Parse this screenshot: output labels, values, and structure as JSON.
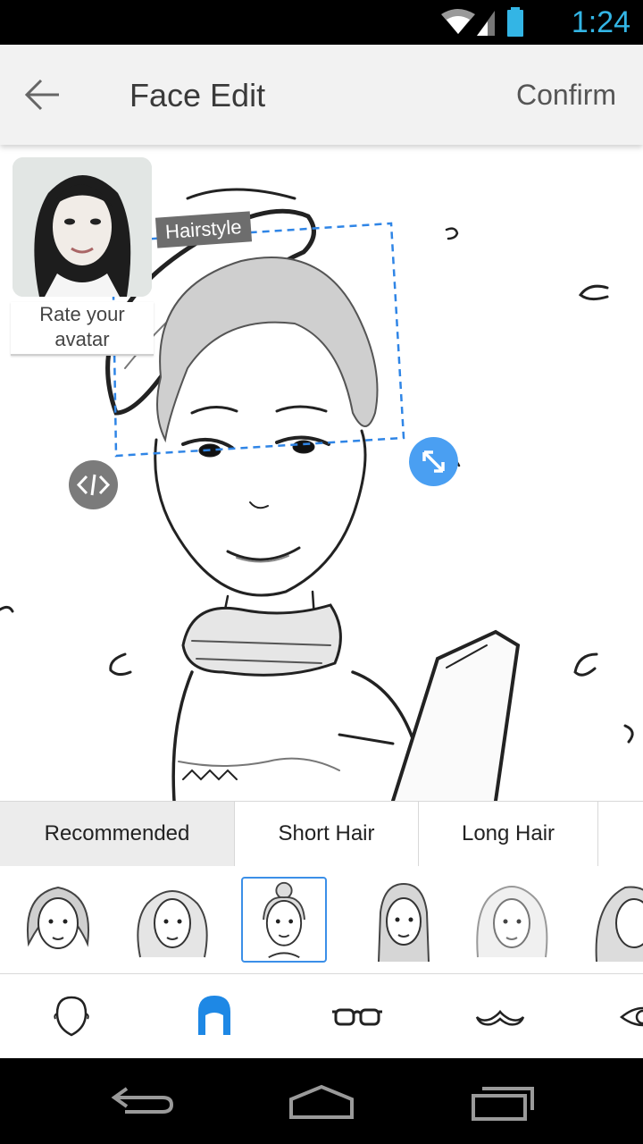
{
  "status_bar": {
    "time": "1:24",
    "icons": [
      "wifi-icon",
      "signal-icon",
      "battery-icon"
    ]
  },
  "header": {
    "title": "Face Edit",
    "confirm_label": "Confirm",
    "back_icon": "back-arrow-icon"
  },
  "canvas": {
    "hairstyle_label": "Hairstyle",
    "rate_label": "Rate your avatar",
    "move_handle_icon": "move-horizontal-icon",
    "resize_handle_icon": "resize-icon"
  },
  "tabs": [
    {
      "label": "Recommended",
      "active": true
    },
    {
      "label": "Short Hair",
      "active": false
    },
    {
      "label": "Long Hair",
      "active": false
    }
  ],
  "hairstyle_thumbnails": [
    "bob-hair",
    "wavy-hair",
    "bun-hair",
    "long-straight-hair",
    "light-long-hair",
    "side-long-hair"
  ],
  "selected_thumbnail": 2,
  "tools": [
    "face-shape-icon",
    "hair-icon",
    "glasses-icon",
    "mustache-icon",
    "eye-icon"
  ],
  "active_tool": 1,
  "nav_bar": [
    "back-nav-icon",
    "home-nav-icon",
    "recents-nav-icon"
  ],
  "colors": {
    "accent": "#3b8fe8",
    "status": "#33b5e5",
    "handle_blue": "#4a9ff2"
  }
}
